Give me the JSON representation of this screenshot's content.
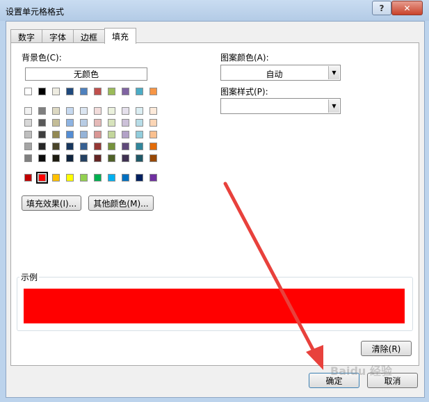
{
  "window": {
    "title": "设置单元格格式",
    "help": "?",
    "close": "✕"
  },
  "tabs": [
    {
      "label": "数字",
      "active": false
    },
    {
      "label": "字体",
      "active": false
    },
    {
      "label": "边框",
      "active": false
    },
    {
      "label": "填充",
      "active": true
    }
  ],
  "background": {
    "label": "背景色(C):",
    "no_color": "无颜色",
    "theme_row": [
      "#ffffff",
      "#000000",
      "#eeece1",
      "#1f497d",
      "#4f81bd",
      "#c0504d",
      "#9bbb59",
      "#8064a2",
      "#4bacc6",
      "#f79646"
    ],
    "shade_rows": [
      [
        "#f2f2f2",
        "#7f7f7f",
        "#ddd9c3",
        "#c6d9f0",
        "#dbe5f1",
        "#f2dcdb",
        "#ebf1dd",
        "#e5e0ec",
        "#dbeef3",
        "#fdeada"
      ],
      [
        "#d8d8d8",
        "#595959",
        "#c4bd97",
        "#8db3e2",
        "#b8cce4",
        "#e5b9b7",
        "#d7e3bc",
        "#ccc1d9",
        "#b7dde8",
        "#fbd5b5"
      ],
      [
        "#bfbfbf",
        "#3f3f3f",
        "#938953",
        "#548dd4",
        "#95b3d7",
        "#d99694",
        "#c3d69b",
        "#b2a2c7",
        "#92cddc",
        "#fac08f"
      ],
      [
        "#a5a5a5",
        "#262626",
        "#494429",
        "#17365d",
        "#366092",
        "#953734",
        "#76923c",
        "#5f497a",
        "#31859b",
        "#e36c09"
      ],
      [
        "#7f7f7f",
        "#0c0c0c",
        "#1d1b10",
        "#0f243e",
        "#244061",
        "#632423",
        "#4f6128",
        "#3f3151",
        "#205867",
        "#974806"
      ]
    ],
    "standard_row": [
      "#c00000",
      "#ff0000",
      "#ffc000",
      "#ffff00",
      "#92d050",
      "#00b050",
      "#00b0f0",
      "#0070c0",
      "#002060",
      "#7030a0"
    ],
    "selected_standard_index": 1,
    "fill_effects": "填充效果(I)...",
    "more_colors": "其他颜色(M)..."
  },
  "pattern": {
    "color_label": "图案颜色(A):",
    "color_value": "自动",
    "style_label": "图案样式(P):",
    "style_value": ""
  },
  "sample": {
    "label": "示例",
    "color": "#ff0000"
  },
  "buttons": {
    "clear": "清除(R)",
    "ok": "确定",
    "cancel": "取消"
  },
  "annotation": {
    "arrow_color": "#e8413c"
  },
  "watermark": "Baidu 经验"
}
